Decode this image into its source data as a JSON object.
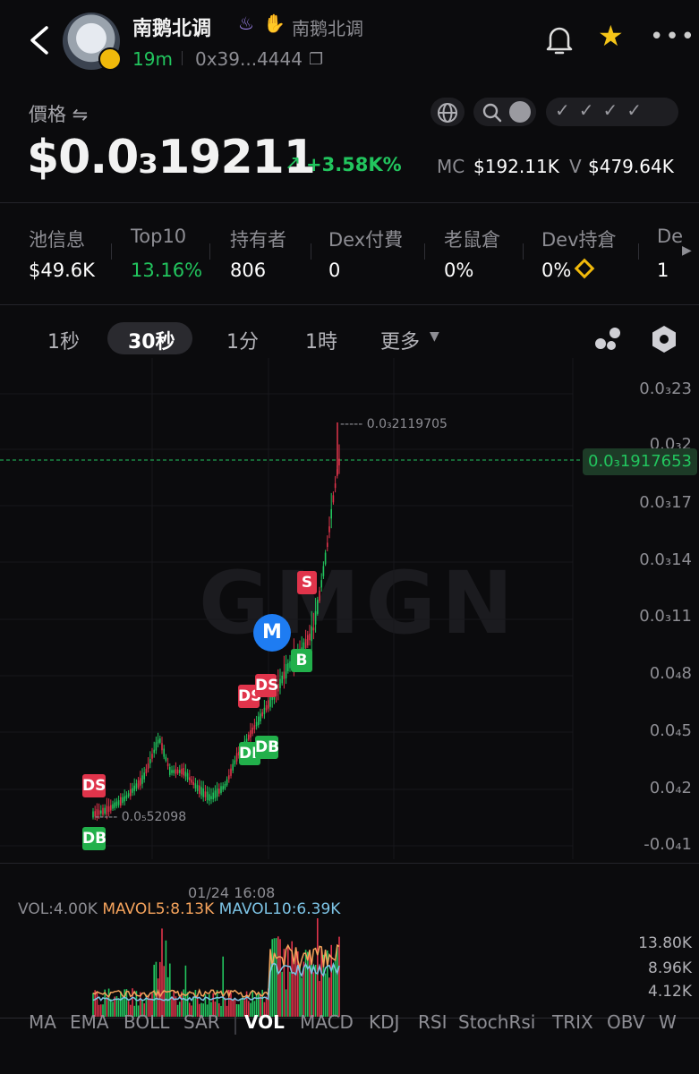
{
  "header": {
    "name": "南鹅北调",
    "subname": "南鹅北调",
    "age": "19m",
    "address": "0x39...4444",
    "icons": [
      "back-icon",
      "flame-icon",
      "hand-icon",
      "copy-icon",
      "bell-icon",
      "star-icon",
      "more-icon"
    ]
  },
  "price": {
    "label": "價格 ⇋",
    "value": "$0.0₃19211",
    "change": "+3.58K%",
    "mc_label": "MC",
    "mc_value": "$192.11K",
    "v_label": "V",
    "v_value": "$479.64K"
  },
  "stats": [
    {
      "label": "池信息",
      "value": "$49.6K"
    },
    {
      "label": "Top10",
      "value": "13.16%"
    },
    {
      "label": "持有者",
      "value": "806"
    },
    {
      "label": "Dex付費",
      "value": "0"
    },
    {
      "label": "老鼠倉",
      "value": "0%"
    },
    {
      "label": "Dev持倉",
      "value": "0%"
    },
    {
      "label": "De",
      "value": "1"
    }
  ],
  "timeframes": [
    "1秒",
    "30秒",
    "1分",
    "1時",
    "更多"
  ],
  "selected_timeframe": "30秒",
  "chart": {
    "watermark": "GMGN",
    "y_ticks": [
      "0.0₃23",
      "0.0₃2",
      "0.0₃17",
      "0.0₃14",
      "0.0₃11",
      "0.0₄8",
      "0.0₄5",
      "0.0₄2",
      "-0.0₄1"
    ],
    "current_price": "0.0₃1917653",
    "high_label": "----- 0.0₃2119705",
    "low_label": "----- 0.0₅52098",
    "markers": [
      "DS",
      "DB",
      "DS",
      "DS",
      "DB",
      "DB",
      "M",
      "B",
      "S"
    ],
    "colors": {
      "up": "#22c55e",
      "down": "#e0344b",
      "accent": "#1e7cf2"
    }
  },
  "volume": {
    "time_label": "01/24 16:08",
    "vol": "VOL:4.00K",
    "mavol5": "MAVOL5:8.13K",
    "mavol10": "MAVOL10:6.39K",
    "ticks": [
      "13.80K",
      "8.96K",
      "4.12K"
    ]
  },
  "indicators": [
    "MA",
    "EMA",
    "BOLL",
    "SAR",
    "VOL",
    "MACD",
    "KDJ",
    "RSI",
    "StochRsi",
    "TRIX",
    "OBV",
    "W"
  ],
  "selected_indicator": "VOL"
}
